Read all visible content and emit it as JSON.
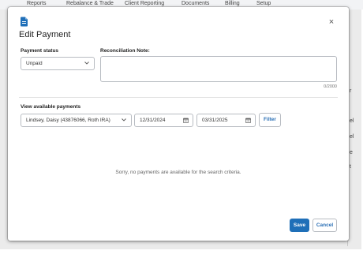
{
  "background_nav": {
    "items": [
      "Reports",
      "Rebalance & Trade",
      "Client Reporting",
      "Documents",
      "Billing",
      "Setup"
    ],
    "right_fragments": [
      "r",
      "el",
      "el",
      "e",
      "t"
    ]
  },
  "modal": {
    "title": "Edit Payment",
    "close_glyph": "×",
    "payment_status": {
      "label": "Payment status",
      "value": "Unpaid"
    },
    "reconciliation": {
      "label": "Reconciliation Note:",
      "value": "",
      "counter": "0/2000"
    },
    "available_payments": {
      "label": "View available payments",
      "account": "Lindsey, Daisy (43876066, Roth IRA)",
      "start_date": "12/31/2024",
      "end_date": "03/31/2025",
      "filter_label": "Filter"
    },
    "empty_message": "Sorry, no payments are available for the search criteria.",
    "footer": {
      "save_label": "Save",
      "cancel_label": "Cancel"
    }
  },
  "colors": {
    "primary": "#1f6fb8",
    "link": "#2a6fb5",
    "border": "#b8bcc2"
  },
  "icons": [
    "document-icon",
    "close-icon",
    "chevron-down-icon",
    "calendar-icon"
  ]
}
